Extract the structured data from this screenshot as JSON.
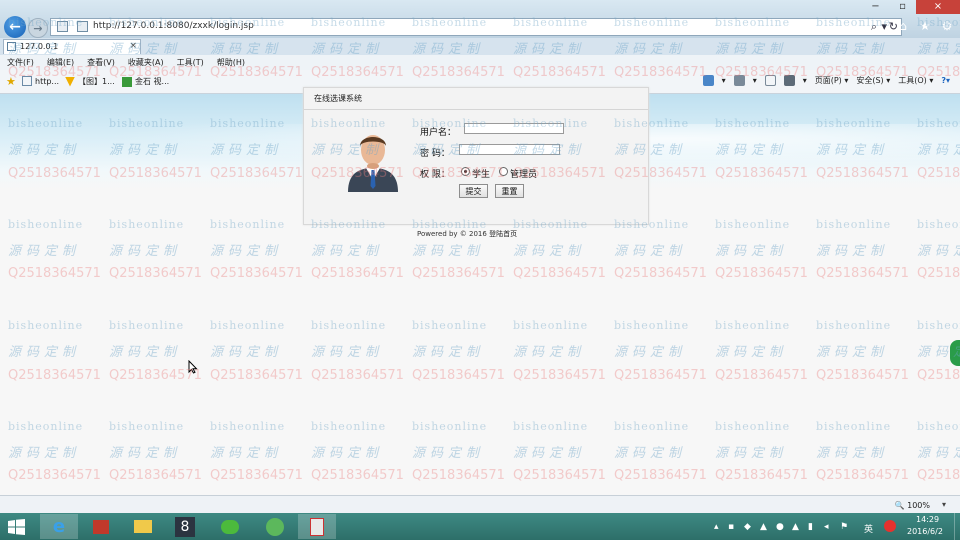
{
  "browser": {
    "address": "http://127.0.0.1:8080/zxxk/login.jsp",
    "tab_label": "127.0.0.1",
    "tab_close": "×",
    "back_glyph": "←",
    "forward_glyph": "→",
    "menu": [
      "文件(F)",
      "编辑(E)",
      "查看(V)",
      "收藏夹(A)",
      "工具(T)",
      "帮助(H)"
    ],
    "favorites": [
      "http...",
      "【图】1...",
      "金石 视..."
    ],
    "commands": [
      "页面(P) ▾",
      "安全(S) ▾",
      "工具(O) ▾"
    ],
    "window_controls": [
      "−",
      "▫",
      "×"
    ]
  },
  "login": {
    "title": "在线选课系统",
    "username_label": "用户名：",
    "username_value": "",
    "password_label": "密  码：",
    "password_value": "",
    "role_label": "权  限：",
    "role_options": [
      "学生",
      "管理员"
    ],
    "role_selected": "学生",
    "submit_label": "提交",
    "reset_label": "重置"
  },
  "footer": {
    "text": "Powered by © 2016",
    "link": "登陆首页"
  },
  "watermark": {
    "site": "bisheonline",
    "cn": "源码定制",
    "qq": "Q2518364571"
  },
  "statusbar": {
    "zoom": "100%"
  },
  "taskbar": {
    "time": "14:29",
    "date": "2016/6/2",
    "ime": "英"
  },
  "colors": {
    "taskbar": "#2d6f69",
    "close_button": "#c7423a",
    "banner_sky": "#bfe0f0"
  }
}
